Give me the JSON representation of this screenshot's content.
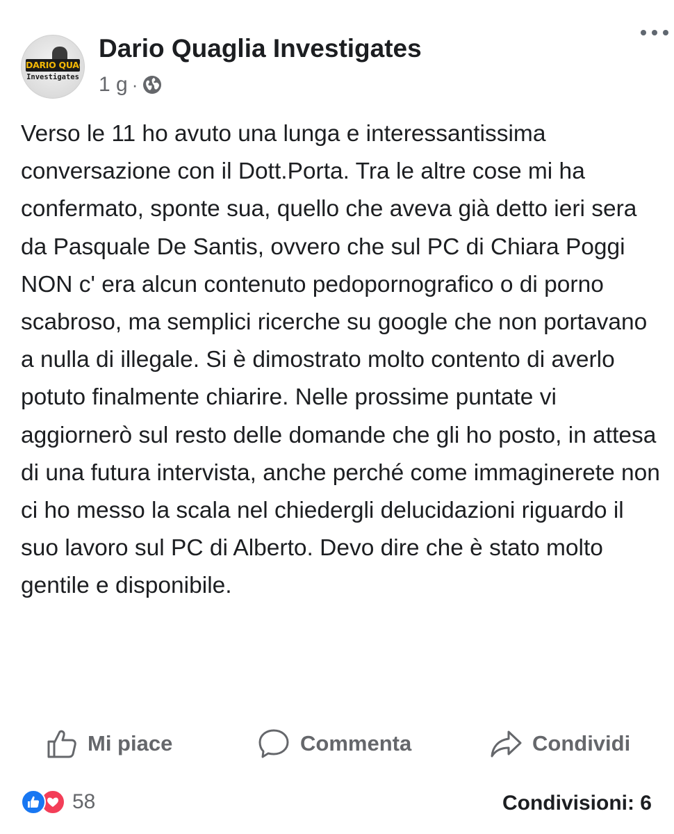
{
  "post": {
    "author": "Dario Quaglia Investigates",
    "avatar_text": "DARIO QUAGLIA",
    "avatar_subtext": "Investigates",
    "time": "1 g",
    "separator": "·",
    "audience_icon": "globe-icon",
    "more_icon": "more-options-icon",
    "body": "Verso le 11 ho avuto una lunga e interessantissima conversazione con il Dott.Porta. Tra le altre cose mi ha confermato, sponte sua, quello che aveva già detto ieri sera da Pasquale De Santis, ovvero che sul PC di Chiara Poggi NON c' era alcun contenuto pedopornografico o di porno scabroso, ma semplici ricerche su google che non portavano a nulla di illegale. Si è dimostrato molto contento di averlo potuto finalmente chiarire. Nelle prossime puntate vi aggiornerò sul resto delle domande che gli ho posto, in attesa di una futura intervista, anche perché come immaginerete non ci ho messo la scala nel chiedergli delucidazioni riguardo il suo lavoro sul PC di Alberto. Devo dire che è stato molto gentile e disponibile."
  },
  "actions": {
    "like_label": "Mi piace",
    "like_icon": "thumbs-up-icon",
    "comment_label": "Commenta",
    "comment_icon": "comment-bubble-icon",
    "share_label": "Condividi",
    "share_icon": "share-arrow-icon"
  },
  "stats": {
    "reaction_icons": [
      "like-reaction-icon",
      "love-reaction-icon"
    ],
    "reaction_count": "58",
    "shares_text": "Condivisioni: 6"
  },
  "colors": {
    "text": "#1c1e21",
    "secondary_text": "#65676b",
    "like_blue": "#1877f2",
    "love_red": "#f33e58",
    "background": "#ffffff"
  }
}
